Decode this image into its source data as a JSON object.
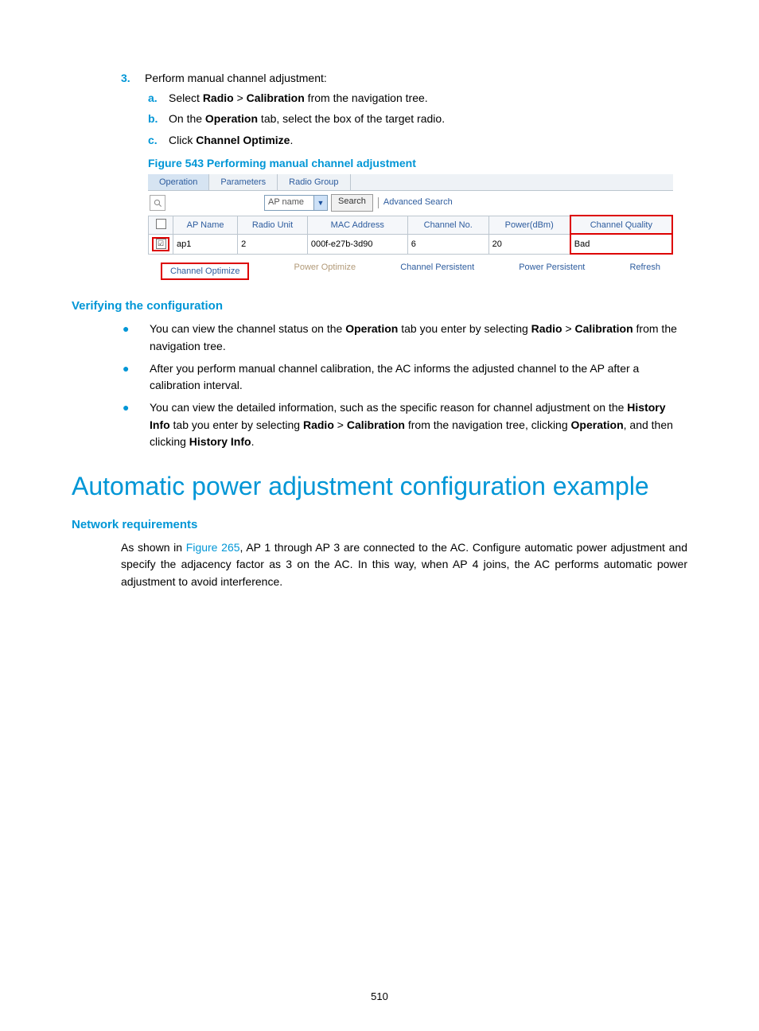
{
  "step3": {
    "num": "3.",
    "text": "Perform manual channel adjustment:",
    "a": {
      "letter": "a.",
      "p1": "Select ",
      "b1": "Radio",
      "mid": " > ",
      "b2": "Calibration",
      "p2": " from the navigation tree."
    },
    "b": {
      "letter": "b.",
      "p1": "On the ",
      "b1": "Operation",
      "p2": " tab, select the box of the target radio."
    },
    "c": {
      "letter": "c.",
      "p1": "Click ",
      "b1": "Channel Optimize",
      "p2": "."
    }
  },
  "figure": {
    "caption": "Figure 543 Performing manual channel adjustment",
    "tabs": {
      "operation": "Operation",
      "parameters": "Parameters",
      "radio_group": "Radio Group"
    },
    "search": {
      "select_value": "AP name",
      "btn": "Search",
      "advanced": "Advanced Search"
    },
    "headers": {
      "ap_name": "AP Name",
      "radio_unit": "Radio Unit",
      "mac": "MAC Address",
      "channel": "Channel No.",
      "power": "Power(dBm)",
      "quality": "Channel Quality"
    },
    "row": {
      "ap_name": "ap1",
      "radio_unit": "2",
      "mac": "000f-e27b-3d90",
      "channel": "6",
      "power": "20",
      "quality": "Bad",
      "check": "☑"
    },
    "actions": {
      "chan_opt": "Channel Optimize",
      "pow_opt": "Power Optimize",
      "chan_pers": "Channel Persistent",
      "pow_pers": "Power Persistent",
      "refresh": "Refresh"
    }
  },
  "verify": {
    "heading": "Verifying the configuration",
    "b1": {
      "p1": "You can view the channel status on the ",
      "b1": "Operation",
      "p2": " tab you enter by selecting ",
      "b2": "Radio",
      "mid": " > ",
      "b3": "Calibration",
      "p3": " from the navigation tree."
    },
    "b2": "After you perform manual channel calibration, the AC informs the adjusted channel to the AP after a calibration interval.",
    "b3": {
      "p1": "You can view the detailed information, such as the specific reason for channel adjustment on the ",
      "b1": "History Info",
      "p2": " tab you enter by selecting ",
      "b2": "Radio",
      "mid": " > ",
      "b3": "Calibration",
      "p3": " from the navigation tree, clicking ",
      "b4": "Operation",
      "p4": ", and then clicking ",
      "b5": "History Info",
      "p5": "."
    }
  },
  "auto": {
    "h1": "Automatic power adjustment configuration example",
    "req_h": "Network requirements",
    "req_p1": "As shown in ",
    "req_link": "Figure 265",
    "req_p2": ", AP 1 through AP 3 are connected to the AC. Configure automatic power adjustment and specify the adjacency factor as 3 on the AC. In this way, when AP 4 joins, the AC performs automatic power adjustment to avoid interference."
  },
  "page_num": "510"
}
